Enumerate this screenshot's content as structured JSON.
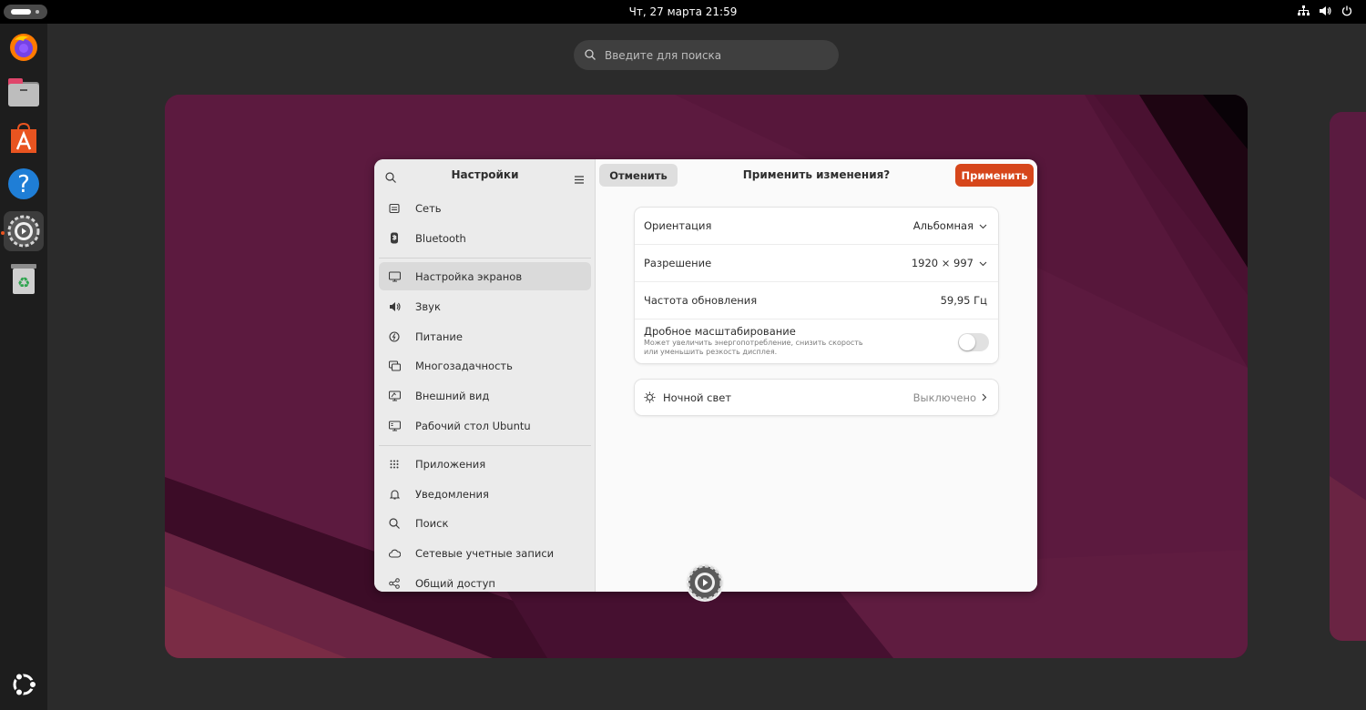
{
  "topbar": {
    "clock": "Чт, 27 марта  21:59"
  },
  "dock": {
    "items": [
      "firefox-icon",
      "files-icon",
      "app-center-icon",
      "help-icon",
      "settings-icon",
      "trash-icon"
    ],
    "bottom": "ubuntu-logo-icon"
  },
  "overview": {
    "search_placeholder": "Введите для поиска"
  },
  "settings": {
    "sidebar": {
      "title": "Настройки",
      "items": [
        {
          "label": "Сеть",
          "icon": "network-icon"
        },
        {
          "label": "Bluetooth",
          "icon": "bluetooth-icon"
        },
        {
          "label": "Настройка экранов",
          "icon": "display-icon"
        },
        {
          "label": "Звук",
          "icon": "sound-icon"
        },
        {
          "label": "Питание",
          "icon": "power-icon"
        },
        {
          "label": "Многозадачность",
          "icon": "multitasking-icon"
        },
        {
          "label": "Внешний вид",
          "icon": "appearance-icon"
        },
        {
          "label": "Рабочий стол Ubuntu",
          "icon": "desktop-icon"
        },
        {
          "label": "Приложения",
          "icon": "apps-icon"
        },
        {
          "label": "Уведомления",
          "icon": "bell-icon"
        },
        {
          "label": "Поиск",
          "icon": "search-icon"
        },
        {
          "label": "Сетевые учетные записи",
          "icon": "cloud-icon"
        },
        {
          "label": "Общий доступ",
          "icon": "share-icon"
        }
      ]
    },
    "header": {
      "cancel_label": "Отменить",
      "title": "Применить изменения?",
      "apply_label": "Применить"
    },
    "display": {
      "orientation": {
        "label": "Ориентация",
        "value": "Альбомная"
      },
      "resolution": {
        "label": "Разрешение",
        "value": "1920 × 997"
      },
      "refresh": {
        "label": "Частота обновления",
        "value": "59,95 Гц"
      },
      "scaling": {
        "label": "Дробное масштабирование",
        "description": "Может увеличить энергопотребление, снизить скорость или уменьшить резкость дисплея.",
        "enabled": false
      },
      "night_light": {
        "label": "Ночной свет",
        "value": "Выключено"
      }
    }
  },
  "colors": {
    "accent": "#d6461b",
    "wallpaper": "#5c1a3f"
  }
}
